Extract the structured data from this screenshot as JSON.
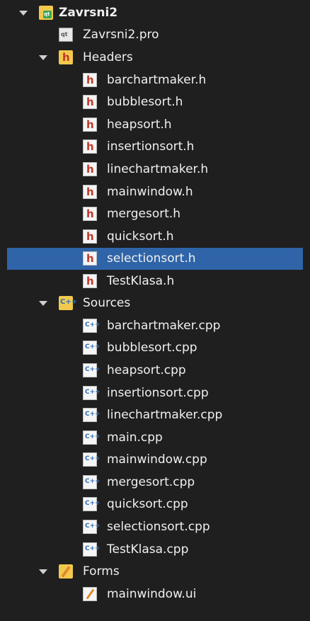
{
  "project": {
    "name": "Zavrsni2",
    "pro_file": "Zavrsni2.pro",
    "headers": {
      "label": "Headers",
      "files": [
        "barchartmaker.h",
        "bubblesort.h",
        "heapsort.h",
        "insertionsort.h",
        "linechartmaker.h",
        "mainwindow.h",
        "mergesort.h",
        "quicksort.h",
        "selectionsort.h",
        "TestKlasa.h"
      ]
    },
    "sources": {
      "label": "Sources",
      "files": [
        "barchartmaker.cpp",
        "bubblesort.cpp",
        "heapsort.cpp",
        "insertionsort.cpp",
        "linechartmaker.cpp",
        "main.cpp",
        "mainwindow.cpp",
        "mergesort.cpp",
        "quicksort.cpp",
        "selectionsort.cpp",
        "TestKlasa.cpp"
      ]
    },
    "forms": {
      "label": "Forms",
      "files": [
        "mainwindow.ui"
      ]
    }
  },
  "selected_file": "selectionsort.h",
  "colors": {
    "background": "#1f1f1f",
    "selection": "#2f64a8",
    "text": "#f0f0f0"
  }
}
